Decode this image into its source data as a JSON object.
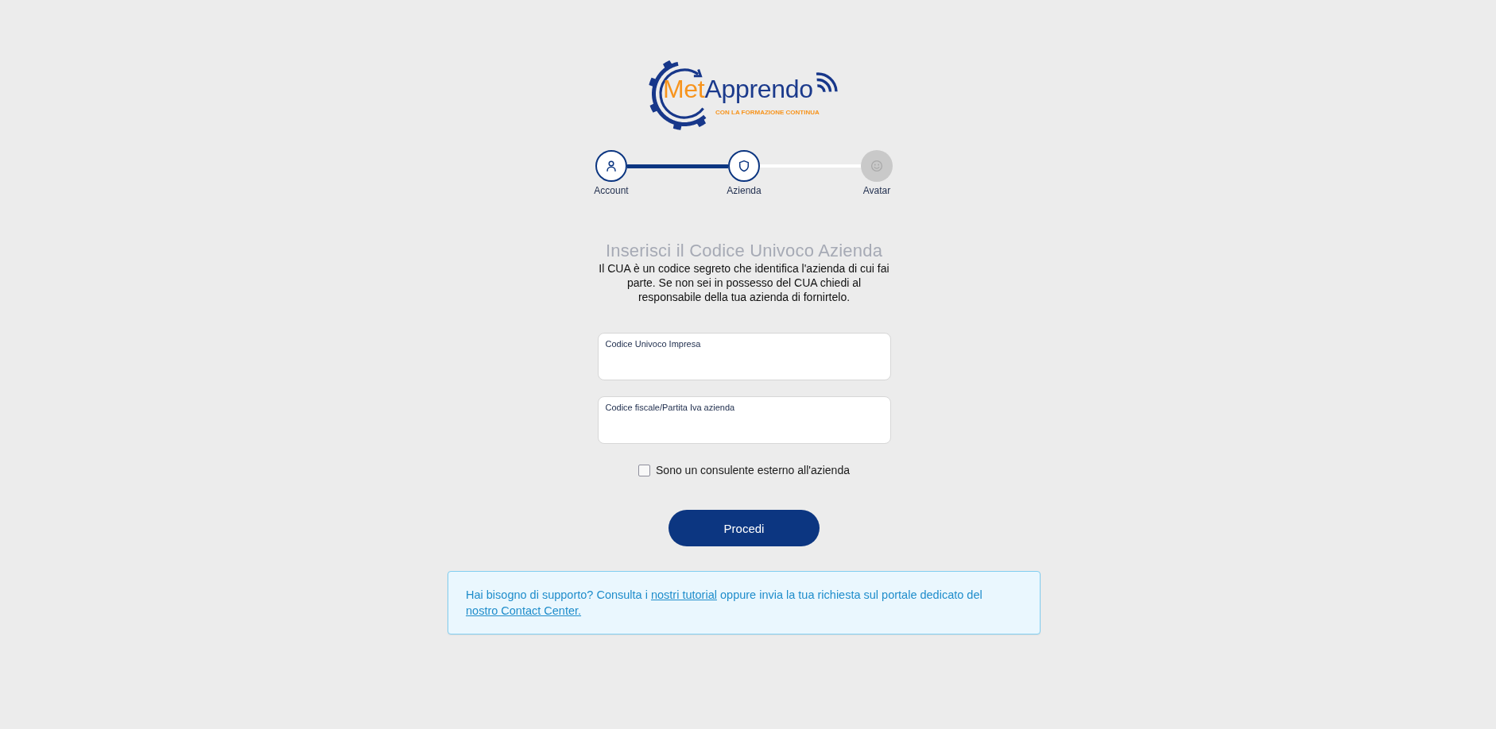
{
  "logo": {
    "wordmark": [
      {
        "text": "Met",
        "color": "#f7941d"
      },
      {
        "text": "Apprendo",
        "color": "#1b3a8c"
      }
    ],
    "tagline": "CON LA FORMAZIONE CONTINUA"
  },
  "steps": [
    {
      "label": "Account",
      "reached": true
    },
    {
      "label": "Azienda",
      "reached": true
    },
    {
      "label": "Avatar",
      "reached": false
    }
  ],
  "heading": "Inserisci il Codice Univoco Azienda",
  "description": "Il CUA è un codice segreto che identifica l'azienda di cui fai parte. Se non sei in possesso del CUA chiedi al responsabile della tua azienda di fornirtelo.",
  "fields": [
    {
      "label": "Codice Univoco Impresa"
    },
    {
      "label": "Codice fiscale/Partita Iva azienda"
    }
  ],
  "consultant_checkbox": {
    "label": "Sono un consulente esterno all'azienda",
    "checked": false
  },
  "submit_button": {
    "label": "Procedi"
  },
  "support_notice": {
    "parts": [
      {
        "kind": "text",
        "text": "Hai bisogno di supporto? Consulta i "
      },
      {
        "kind": "link",
        "text": "nostri tutorial"
      },
      {
        "kind": "text",
        "text": " oppure invia la tua richiesta sul portale dedicato del "
      },
      {
        "kind": "link",
        "text": "nostro Contact Center."
      }
    ]
  }
}
